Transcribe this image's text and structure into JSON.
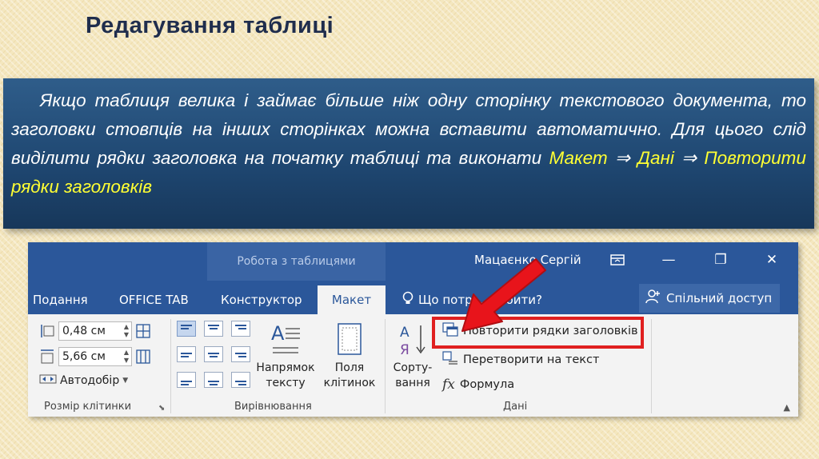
{
  "slide": {
    "title": "Редагування таблиці",
    "text_plain_1": "Якщо таблиця велика і займає більше ніж одну сторінку текстового документа, то заголовки стовпців на інших сторінках можна вставити автоматично. Для цього слід виділити рядки заголовка на початку таблиці та виконати ",
    "path_1": "Макет",
    "arrow": "⇒",
    "path_2": "Дані",
    "path_3": "Повторити рядки заголовків",
    "colors": {
      "title": "#1f2d4d",
      "box": "#1e4670",
      "highlight": "#ffff33"
    }
  },
  "ribbon": {
    "context_title": "Робота з таблицями",
    "user_name": "Мацаєнко Сергій",
    "window_buttons": {
      "restore_ribbon_icon": "ribbon-display-icon",
      "minimize": "—",
      "maximize": "❐",
      "close": "✕"
    },
    "tabs": [
      {
        "label": "Подання",
        "active": false
      },
      {
        "label": "OFFICE TAB",
        "active": false
      },
      {
        "label": "Конструктор",
        "active": false
      },
      {
        "label": "Макет",
        "active": true
      },
      {
        "label": "Що потрі... робити?",
        "active": false
      }
    ],
    "share_label": "Спільний доступ",
    "cell_size": {
      "height_value": "0,48 см",
      "width_value": "5,66 см",
      "autofit_label": "Автодобір",
      "group_label": "Розмір клітинки"
    },
    "alignment": {
      "direction_label_1": "Напрямок",
      "direction_label_2": "тексту",
      "margins_label_1": "Поля",
      "margins_label_2": "клітинок",
      "group_label": "Вирівнювання"
    },
    "data": {
      "sort_label_1": "Сорту-",
      "sort_label_2": "вання",
      "repeat_header": "Повторити рядки заголовків",
      "convert_text": "Перетворити на текст",
      "formula": "Формула",
      "group_label": "Дані"
    },
    "colors": {
      "ribbon_blue": "#2b579a",
      "annotation_red": "#e02020"
    }
  }
}
